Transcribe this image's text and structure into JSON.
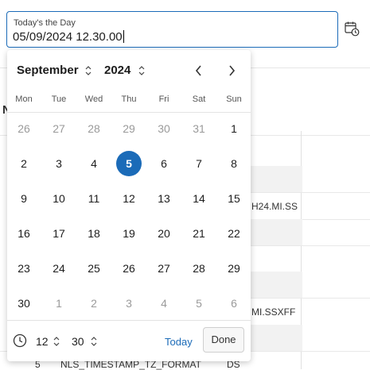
{
  "field": {
    "label": "Today's the Day",
    "value": "05/09/2024 12.30.00"
  },
  "background": {
    "partial_heading": "N",
    "rows": [
      {
        "text": "H24.MI.SS"
      },
      {
        "text": "MI.SSXFF"
      },
      {
        "text": "5"
      },
      {
        "text": "NLS_TIMESTAMP_TZ_FORMAT"
      },
      {
        "text": "DS"
      }
    ]
  },
  "calendar": {
    "month": "September",
    "year": "2024",
    "weekdays": [
      "Mon",
      "Tue",
      "Wed",
      "Thu",
      "Fri",
      "Sat",
      "Sun"
    ],
    "weeks": [
      [
        {
          "d": "26",
          "m": true
        },
        {
          "d": "27",
          "m": true
        },
        {
          "d": "28",
          "m": true
        },
        {
          "d": "29",
          "m": true
        },
        {
          "d": "30",
          "m": true
        },
        {
          "d": "31",
          "m": true
        },
        {
          "d": "1"
        }
      ],
      [
        {
          "d": "2"
        },
        {
          "d": "3"
        },
        {
          "d": "4"
        },
        {
          "d": "5",
          "sel": true
        },
        {
          "d": "6"
        },
        {
          "d": "7"
        },
        {
          "d": "8"
        }
      ],
      [
        {
          "d": "9"
        },
        {
          "d": "10"
        },
        {
          "d": "11"
        },
        {
          "d": "12"
        },
        {
          "d": "13"
        },
        {
          "d": "14"
        },
        {
          "d": "15"
        }
      ],
      [
        {
          "d": "16"
        },
        {
          "d": "17"
        },
        {
          "d": "18"
        },
        {
          "d": "19"
        },
        {
          "d": "20"
        },
        {
          "d": "21"
        },
        {
          "d": "22"
        }
      ],
      [
        {
          "d": "23"
        },
        {
          "d": "24"
        },
        {
          "d": "25"
        },
        {
          "d": "26"
        },
        {
          "d": "27"
        },
        {
          "d": "28"
        },
        {
          "d": "29"
        }
      ],
      [
        {
          "d": "30"
        },
        {
          "d": "1",
          "m": true
        },
        {
          "d": "2",
          "m": true
        },
        {
          "d": "3",
          "m": true
        },
        {
          "d": "4",
          "m": true
        },
        {
          "d": "5",
          "m": true
        },
        {
          "d": "6",
          "m": true
        }
      ]
    ],
    "hour": "12",
    "minute": "30",
    "today_label": "Today",
    "done_label": "Done"
  },
  "colors": {
    "accent": "#1b6bb8",
    "muted_text": "#9a9a9a"
  },
  "icons": {
    "calendar_button": "calendar-clock-icon",
    "prev": "chevron-left-icon",
    "next": "chevron-right-icon",
    "clock": "clock-icon",
    "spinner": "chevron-up-down-icon"
  }
}
